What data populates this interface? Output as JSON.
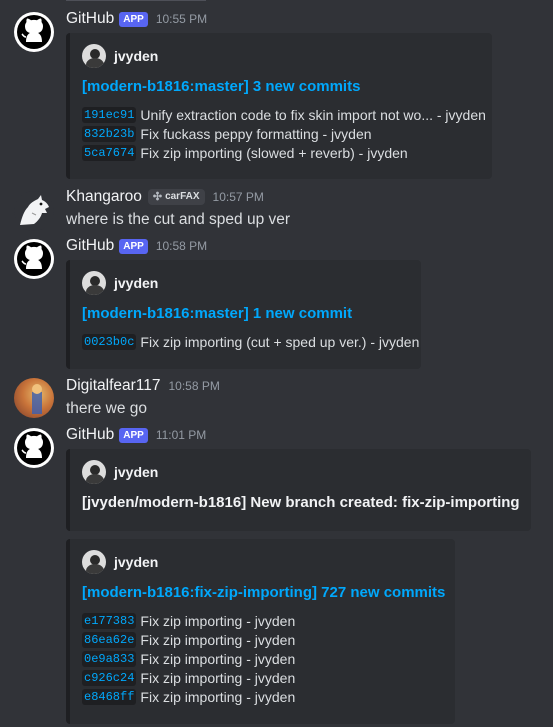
{
  "messages": [
    {
      "author": "GitHub",
      "badge": "APP",
      "time": "10:55 PM",
      "embed": {
        "author": "jvyden",
        "title": "[modern-b1816:master] 3 new commits",
        "commits": [
          {
            "sha": "191ec91",
            "text": "Unify extraction code to fix skin import not wo... - jvyden"
          },
          {
            "sha": "832b23b",
            "text": "Fix fuckass peppy formatting - jvyden"
          },
          {
            "sha": "5ca7674",
            "text": "Fix zip importing (slowed + reverb) - jvyden"
          }
        ]
      }
    },
    {
      "author": "Khangaroo",
      "tag": "carFAX",
      "time": "10:57 PM",
      "text": "where is the cut and sped up ver"
    },
    {
      "author": "GitHub",
      "badge": "APP",
      "time": "10:58 PM",
      "embed": {
        "author": "jvyden",
        "title": "[modern-b1816:master] 1 new commit",
        "commits": [
          {
            "sha": "0023b0c",
            "text": "Fix zip importing (cut + sped up ver.) - jvyden"
          }
        ]
      }
    },
    {
      "author": "Digitalfear117",
      "time": "10:58 PM",
      "text": "there we go"
    },
    {
      "author": "GitHub",
      "badge": "APP",
      "time": "11:01 PM",
      "embeds": [
        {
          "author": "jvyden",
          "title": "[jvyden/modern-b1816] New branch created: fix-zip-importing"
        },
        {
          "author": "jvyden",
          "title": "[modern-b1816:fix-zip-importing] 727 new commits",
          "commits": [
            {
              "sha": "e177383",
              "text": "Fix zip importing - jvyden"
            },
            {
              "sha": "86ea62e",
              "text": "Fix zip importing - jvyden"
            },
            {
              "sha": "0e9a833",
              "text": "Fix zip importing - jvyden"
            },
            {
              "sha": "c926c24",
              "text": "Fix zip importing - jvyden"
            },
            {
              "sha": "e8468ff",
              "text": "Fix zip importing - jvyden"
            }
          ]
        }
      ]
    }
  ]
}
